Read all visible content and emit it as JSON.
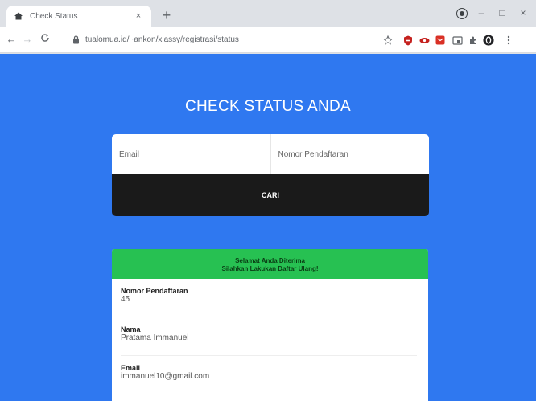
{
  "browser": {
    "tab_title": "Check Status",
    "tab_close": "×",
    "new_tab": "+",
    "url": "tualomua.id/~ankon/xlassy/registrasi/status",
    "window_controls": {
      "minimize": "–",
      "maximize": "□",
      "close": "×"
    },
    "nav": {
      "back": "←",
      "forward": "→",
      "reload": "C"
    }
  },
  "page": {
    "title": "CHECK STATUS ANDA",
    "form": {
      "email_placeholder": "Email",
      "nomor_placeholder": "Nomor Pendaftaran",
      "submit_label": "CARI"
    },
    "result": {
      "banner_line1": "Selamat Anda Diterima",
      "banner_line2": "Silahkan Lakukan Daftar Ulang!",
      "rows": [
        {
          "label": "Nomor Pendaftaran",
          "value": "45"
        },
        {
          "label": "Nama",
          "value": "Pratama Immanuel"
        },
        {
          "label": "Email",
          "value": "immanuel10@gmail.com"
        }
      ]
    }
  },
  "colors": {
    "page_bg": "#2f78f0",
    "button_bg": "#1a1a1a",
    "banner_bg": "#27c152"
  },
  "icons": [
    "home-icon",
    "lock-icon",
    "star-icon",
    "shield-icon",
    "extension-icon",
    "profile-icon",
    "menu-icon"
  ]
}
